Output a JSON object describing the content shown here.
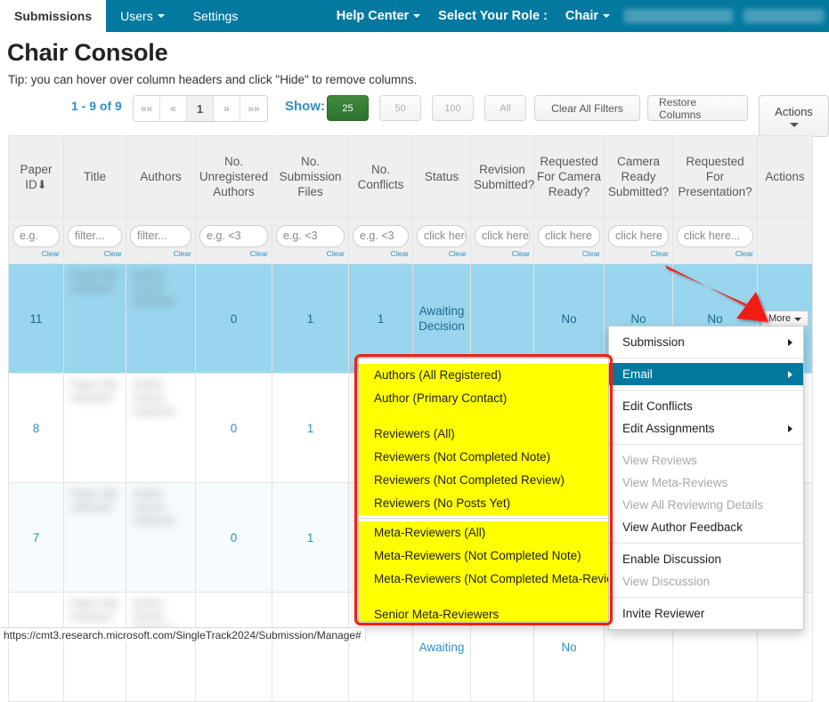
{
  "navbar": {
    "left_items": [
      {
        "label": "Submissions",
        "active": true,
        "caret": false
      },
      {
        "label": "Users",
        "active": false,
        "caret": true
      },
      {
        "label": "Settings",
        "active": false,
        "caret": false
      }
    ],
    "right_items": [
      {
        "label": "Help Center",
        "caret": true
      },
      {
        "label": "Select Your Role :",
        "caret": false
      },
      {
        "label": "Chair",
        "caret": true
      }
    ],
    "brand_color": "#0479a0"
  },
  "page": {
    "title": "Chair Console",
    "tip": "Tip: you can hover over column headers and click \"Hide\" to remove columns."
  },
  "toolbar": {
    "count_label": "1 - 9 of 9",
    "pager": [
      "««",
      "«",
      "1",
      "»",
      "»»"
    ],
    "pager_current_index": 2,
    "show_label": "Show:",
    "show_options": [
      "25",
      "50",
      "100",
      "All"
    ],
    "show_selected": "25",
    "clear_filters_label": "Clear All Filters",
    "restore_columns_label": "Restore Columns",
    "actions_label": "Actions",
    "selected_color": "#2f722f"
  },
  "table": {
    "columns": [
      {
        "label": "Paper ID",
        "sorted": true,
        "filter": "e.g.",
        "clear": "Clear"
      },
      {
        "label": "Title",
        "sorted": false,
        "filter": "filter...",
        "clear": "Clear"
      },
      {
        "label": "Authors",
        "sorted": false,
        "filter": "filter...",
        "clear": "Clear"
      },
      {
        "label": "No. Unregistered Authors",
        "sorted": false,
        "filter": "e.g. <3",
        "clear": "Clear"
      },
      {
        "label": "No. Submission Files",
        "sorted": false,
        "filter": "e.g. <3",
        "clear": "Clear"
      },
      {
        "label": "No. Conflicts",
        "sorted": false,
        "filter": "e.g. <3",
        "clear": "Clear"
      },
      {
        "label": "Status",
        "sorted": false,
        "filter": "click here",
        "clear": "Clear"
      },
      {
        "label": "Revision Submitted?",
        "sorted": false,
        "filter": "click here",
        "clear": "Clear"
      },
      {
        "label": "Requested For Camera Ready?",
        "sorted": false,
        "filter": "click here",
        "clear": "Clear"
      },
      {
        "label": "Camera Ready Submitted?",
        "sorted": false,
        "filter": "click here",
        "clear": "Clear"
      },
      {
        "label": "Requested For Presentation?",
        "sorted": false,
        "filter": "click here...",
        "clear": "Clear"
      },
      {
        "label": "Actions",
        "sorted": false,
        "filter": "",
        "clear": ""
      }
    ],
    "sort_arrow": "⬇",
    "rows": [
      {
        "paper_id": "11",
        "title": "",
        "authors": "",
        "unregistered_authors": "0",
        "submission_files": "1",
        "conflicts": "1",
        "status": "Awaiting Decision",
        "revision_submitted": "",
        "requested_camera_ready": "No",
        "camera_ready_submitted": "No",
        "requested_presentation": "No",
        "action_label": "More",
        "selected": true
      },
      {
        "paper_id": "8",
        "title": "",
        "authors": "",
        "unregistered_authors": "0",
        "submission_files": "1",
        "conflicts": "",
        "status": "",
        "revision_submitted": "",
        "requested_camera_ready": "",
        "camera_ready_submitted": "",
        "requested_presentation": "",
        "action_label": "",
        "selected": false
      },
      {
        "paper_id": "7",
        "title": "",
        "authors": "",
        "unregistered_authors": "0",
        "submission_files": "1",
        "conflicts": "",
        "status": "",
        "revision_submitted": "",
        "requested_camera_ready": "",
        "camera_ready_submitted": "",
        "requested_presentation": "",
        "action_label": "",
        "selected": false
      },
      {
        "paper_id": "",
        "title": "",
        "authors": "",
        "unregistered_authors": "",
        "submission_files": "",
        "conflicts": "",
        "status": "Awaiting",
        "revision_submitted": "",
        "requested_camera_ready": "No",
        "camera_ready_submitted": "",
        "requested_presentation": "",
        "action_label": "",
        "selected": false
      }
    ]
  },
  "context_menu": {
    "items": [
      {
        "label": "Submission",
        "submenu": true,
        "disabled": false,
        "highlight": false
      },
      {
        "sep": true
      },
      {
        "label": "Email",
        "submenu": true,
        "disabled": false,
        "highlight": true
      },
      {
        "sep": true
      },
      {
        "label": "Edit Conflicts",
        "submenu": false,
        "disabled": false,
        "highlight": false
      },
      {
        "label": "Edit Assignments",
        "submenu": true,
        "disabled": false,
        "highlight": false
      },
      {
        "sep": true
      },
      {
        "label": "View Reviews",
        "submenu": false,
        "disabled": true,
        "highlight": false
      },
      {
        "label": "View Meta-Reviews",
        "submenu": false,
        "disabled": true,
        "highlight": false
      },
      {
        "label": "View All Reviewing Details",
        "submenu": false,
        "disabled": true,
        "highlight": false
      },
      {
        "label": "View Author Feedback",
        "submenu": false,
        "disabled": false,
        "highlight": false
      },
      {
        "sep": true
      },
      {
        "label": "Enable Discussion",
        "submenu": false,
        "disabled": false,
        "highlight": false
      },
      {
        "label": "View Discussion",
        "submenu": false,
        "disabled": true,
        "highlight": false
      },
      {
        "sep": true
      },
      {
        "label": "Invite Reviewer",
        "submenu": false,
        "disabled": false,
        "highlight": false
      }
    ],
    "highlight_color": "#0479a0"
  },
  "email_submenu": {
    "highlight_color": "#ffff00",
    "outline_color": "#f21f12",
    "groups": [
      {
        "items": [
          "Authors (All Registered)",
          "Author (Primary Contact)"
        ]
      },
      {
        "items": [
          "Reviewers (All)",
          "Reviewers (Not Completed Note)",
          "Reviewers (Not Completed Review)",
          "Reviewers (No Posts Yet)"
        ]
      },
      {
        "items": [
          "Meta-Reviewers (All)",
          "Meta-Reviewers (Not Completed Note)",
          "Meta-Reviewers (Not Completed Meta-Review)"
        ]
      },
      {
        "items": [
          "Senior Meta-Reviewers"
        ]
      }
    ]
  },
  "status_bar": {
    "url": "https://cmt3.research.microsoft.com/SingleTrack2024/Submission/Manage#"
  },
  "annotation": {
    "arrow_color": "#f21f12"
  }
}
